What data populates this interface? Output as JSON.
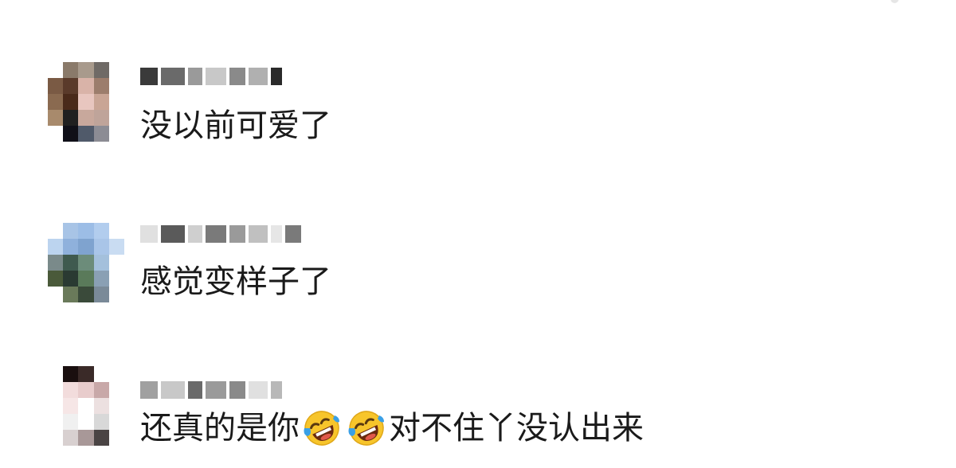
{
  "comments": [
    {
      "text": "没以前可爱了",
      "avatar_colors": [
        "#ffffff",
        "#8a7a6a",
        "#a89a8c",
        "#6f6a66",
        "#ffffff",
        "#7a5a44",
        "#5a3a2a",
        "#d9b3a8",
        "#9c7d6c",
        "#ffffff",
        "#8a6a50",
        "#4a2a1a",
        "#e8c6bf",
        "#c9a595",
        "#ffffff",
        "#a88a6c",
        "#202020",
        "#c8a89c",
        "#bfa49a",
        "#ffffff",
        "#ffffff",
        "#101018",
        "#505a6a",
        "#8c8c94",
        "#ffffff"
      ],
      "name_blocks": [
        "#3a3a3a",
        "#6a6a6a",
        "#9a9a9a",
        "#c8c8c8",
        "#8a8a8a",
        "#b0b0b0",
        "#2a2a2a"
      ]
    },
    {
      "text": "感觉变样子了",
      "avatar_colors": [
        "#ffffff",
        "#a8c4e6",
        "#9cbde6",
        "#b2cdee",
        "#ffffff",
        "#bcd4ef",
        "#8fb1dc",
        "#7fa3cf",
        "#a9c5e8",
        "#c9dcf2",
        "#7a8a8a",
        "#3f5a4f",
        "#6c8c7a",
        "#a4c0dc",
        "#ffffff",
        "#4a5a3a",
        "#2a3a32",
        "#5a7a5a",
        "#8aa0b4",
        "#ffffff",
        "#ffffff",
        "#6a7a5a",
        "#3a4a3a",
        "#7a8a98",
        "#ffffff"
      ],
      "name_blocks": [
        "#e0e0e0",
        "#5a5a5a",
        "#cfcfcf",
        "#7a7a7a",
        "#9a9a9a",
        "#c0c0c0",
        "#e6e6e6",
        "#7a7a7a"
      ]
    },
    {
      "text_before": "还真的是你",
      "text_after": "对不住丫没认出来",
      "emoji_icons": [
        "rolling-on-floor-laughing-icon",
        "rolling-on-floor-laughing-icon"
      ],
      "avatar_colors": [
        "#ffffff",
        "#1a0f0f",
        "#3a2a28",
        "#ffffff",
        "#ffffff",
        "#ffffff",
        "#f2dcdc",
        "#e8cccc",
        "#c8a8a8",
        "#ffffff",
        "#ffffff",
        "#f6e6e6",
        "#ffffff",
        "#ece0e0",
        "#ffffff",
        "#ffffff",
        "#f0f0f0",
        "#ffffff",
        "#d8d8d8",
        "#ffffff",
        "#ffffff",
        "#d8d0d0",
        "#a89898",
        "#4a4444",
        "#ffffff"
      ],
      "name_blocks": [
        "#a0a0a0",
        "#c8c8c8",
        "#6a6a6a",
        "#9a9a9a",
        "#8a8a8a",
        "#e0e0e0",
        "#b8b8b8"
      ]
    }
  ]
}
